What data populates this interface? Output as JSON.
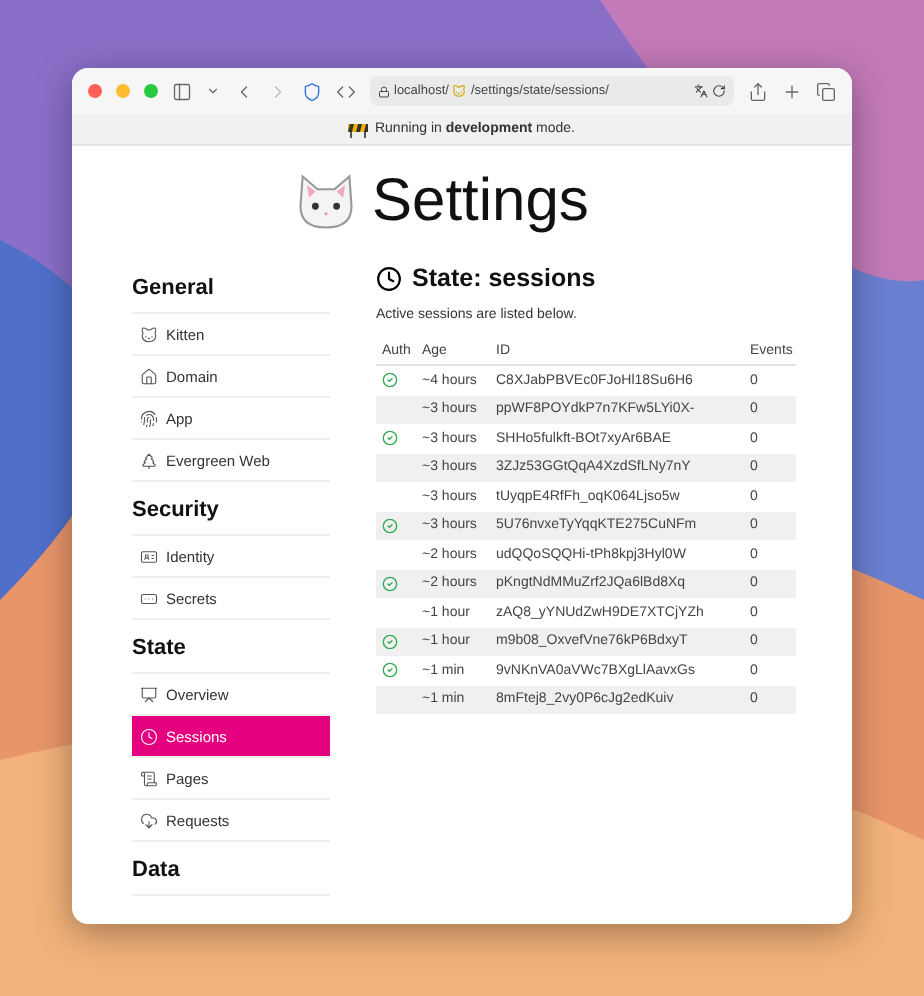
{
  "browser": {
    "url_start": "localhost/",
    "url_end": "/settings/state/sessions/",
    "banner": "Running in **development** mode."
  },
  "page": {
    "title": "Settings"
  },
  "sidebar": {
    "sections": [
      {
        "title": "General",
        "items": [
          {
            "label": "Kitten",
            "selected": false
          },
          {
            "label": "Domain",
            "selected": false
          },
          {
            "label": "App",
            "selected": false
          },
          {
            "label": "Evergreen Web",
            "selected": false
          }
        ]
      },
      {
        "title": "Security",
        "items": [
          {
            "label": "Identity",
            "selected": false
          },
          {
            "label": "Secrets",
            "selected": false
          }
        ]
      },
      {
        "title": "State",
        "items": [
          {
            "label": "Overview",
            "selected": false
          },
          {
            "label": "Sessions",
            "selected": true
          },
          {
            "label": "Pages",
            "selected": false
          },
          {
            "label": "Requests",
            "selected": false
          }
        ]
      },
      {
        "title": "Data"
      }
    ]
  },
  "main": {
    "title": "State: sessions",
    "description": "Active sessions are listed below.",
    "table": {
      "columns": [
        "Auth",
        "Age",
        "ID",
        "Events"
      ],
      "rows": [
        {
          "authenticated": true,
          "age": "~4 hours",
          "id": "C8XJabPBVEc0FJoHl18Su6H6",
          "events": "0"
        },
        {
          "authenticated": false,
          "age": "~3 hours",
          "id": "ppWF8POYdkP7n7KFw5LYi0X-",
          "events": "0"
        },
        {
          "authenticated": true,
          "age": "~3 hours",
          "id": "SHHo5fulkft-BOt7xyAr6BAE",
          "events": "0"
        },
        {
          "authenticated": false,
          "age": "~3 hours",
          "id": "3ZJz53GGtQqA4XzdSfLNy7nY",
          "events": "0"
        },
        {
          "authenticated": false,
          "age": "~3 hours",
          "id": "tUyqpE4RfFh_oqK064Ljso5w",
          "events": "0"
        },
        {
          "authenticated": true,
          "age": "~3 hours",
          "id": "5U76nvxeTyYqqKTE275CuNFm",
          "events": "0"
        },
        {
          "authenticated": false,
          "age": "~2 hours",
          "id": "udQQoSQQHi-tPh8kpj3Hyl0W",
          "events": "0"
        },
        {
          "authenticated": true,
          "age": "~2 hours",
          "id": "pKngtNdMMuZrf2JQa6lBd8Xq",
          "events": "0"
        },
        {
          "authenticated": false,
          "age": "~1 hour",
          "id": "zAQ8_yYNUdZwH9DE7XTCjYZh",
          "events": "0"
        },
        {
          "authenticated": true,
          "age": "~1 hour",
          "id": "m9b08_OxvefVne76kP6BdxyT",
          "events": "0"
        },
        {
          "authenticated": true,
          "age": "~1 min",
          "id": "9vNKnVA0aVWc7BXgLlAavxGs",
          "events": "0"
        },
        {
          "authenticated": false,
          "age": "~1 min",
          "id": "8mFtej8_2vy0P6cJg2edKuiv",
          "events": "0"
        }
      ]
    }
  }
}
